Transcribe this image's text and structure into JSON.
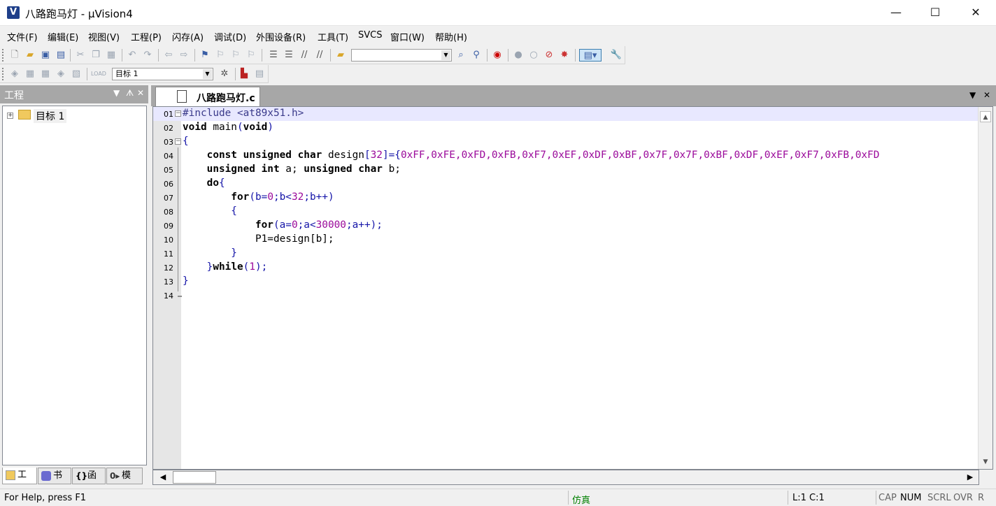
{
  "window": {
    "title": "八路跑马灯  - µVision4",
    "icon_glyph": "V",
    "minimize": "—",
    "maximize": "☐",
    "close": "✕"
  },
  "menu": [
    "文件(F)",
    "编辑(E)",
    "视图(V)",
    "工程(P)",
    "闪存(A)",
    "调试(D)",
    "外围设备(R)",
    "工具(T)",
    "SVCS",
    "窗口(W)",
    "帮助(H)"
  ],
  "toolbar": {
    "target_select": "目标 1",
    "find_combo": ""
  },
  "project_panel": {
    "title": "工程",
    "pin": "ᗑ",
    "close": "✕",
    "tree_root": "目标 1",
    "tabs": [
      "工",
      "书",
      "函",
      "模"
    ]
  },
  "editor": {
    "file_tab": "八路跑马灯.c",
    "lines": [
      {
        "n": "01"
      },
      {
        "n": "02"
      },
      {
        "n": "03"
      },
      {
        "n": "04"
      },
      {
        "n": "05"
      },
      {
        "n": "06"
      },
      {
        "n": "07"
      },
      {
        "n": "08"
      },
      {
        "n": "09"
      },
      {
        "n": "10"
      },
      {
        "n": "11"
      },
      {
        "n": "12"
      },
      {
        "n": "13"
      },
      {
        "n": "14"
      }
    ],
    "code": {
      "l1": "#include <at89x51.h>",
      "l2a": "void",
      "l2b": " main",
      "l2c": "(",
      "l2d": "void",
      "l2e": ")",
      "l3": "{",
      "l4a": "    const unsigned char",
      "l4b": " design",
      "l4c": "[",
      "l4d": "32",
      "l4e": "]={",
      "l4f": "0xFF,0xFE,0xFD,0xFB,0xF7,0xEF,0xDF,0xBF,0x7F,0x7F,0xBF,0xDF,0xEF,0xF7,0xFB,0xFD",
      "l5a": "    unsigned int",
      "l5b": " a; ",
      "l5c": "unsigned char",
      "l5d": " b;",
      "l6a": "    do",
      "l6b": "{",
      "l7a": "        for",
      "l7b": "(b=",
      "l7c": "0",
      "l7d": ";b<",
      "l7e": "32",
      "l7f": ";b++)",
      "l8": "        {",
      "l9a": "            for",
      "l9b": "(a=",
      "l9c": "0",
      "l9d": ";a<",
      "l9e": "30000",
      "l9f": ";a++);",
      "l10": "            P1=design[b];",
      "l11": "        }",
      "l12a": "    }",
      "l12b": "while",
      "l12c": "(",
      "l12d": "1",
      "l12e": ");",
      "l13": "}"
    }
  },
  "status": {
    "help": "For Help, press F1",
    "mode": "仿真",
    "position": "L:1 C:1",
    "cap": "CAP",
    "num": "NUM",
    "scrl": "SCRL",
    "ovr": "OVR",
    "rw": "R"
  },
  "colors": {
    "keyword": "#000000",
    "number": "#9b0a9b",
    "status_mode": "#008000",
    "panel_header": "#a7a7a7"
  }
}
